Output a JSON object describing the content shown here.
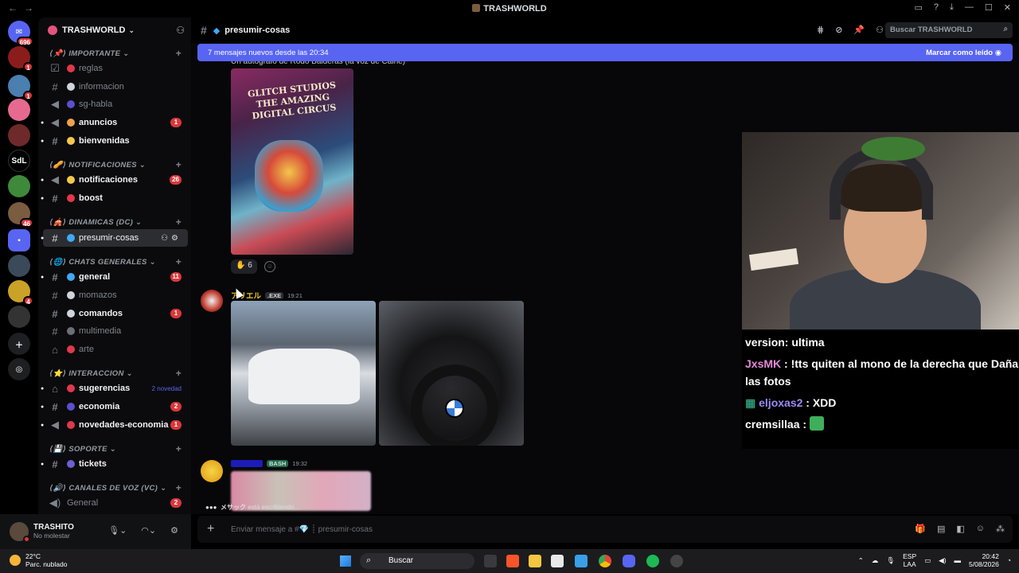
{
  "window": {
    "title": "TRASHWORLD",
    "nav_back": "←",
    "nav_forward": "→"
  },
  "rail": {
    "badges": [
      "696",
      "1",
      "1",
      "46",
      "4"
    ],
    "text_server": "SdL"
  },
  "server": {
    "name": "TRASHWORLD"
  },
  "sidebar": {
    "categories": [
      "IMPORTANTE",
      "NOTIFICACIONES",
      "DINAMICAS (DC)",
      "CHATS GENERALES",
      "INTERACCION",
      "SOPORTE",
      "CANALES DE VOZ (VC)"
    ],
    "channels": [
      {
        "label": "reglas"
      },
      {
        "label": "informacion"
      },
      {
        "label": "sg-habla"
      },
      {
        "label": "anuncios",
        "count": "1"
      },
      {
        "label": "bienvenidas"
      },
      {
        "label": "notificaciones",
        "count": "26"
      },
      {
        "label": "boost"
      },
      {
        "label": "presumir-cosas"
      },
      {
        "label": "general",
        "count": "11"
      },
      {
        "label": "momazos"
      },
      {
        "label": "comandos",
        "count": "1"
      },
      {
        "label": "multimedia"
      },
      {
        "label": "arte"
      },
      {
        "label": "sugerencias",
        "new": "2 novedad"
      },
      {
        "label": "economia",
        "count": "2"
      },
      {
        "label": "novedades-economia",
        "count": "1"
      },
      {
        "label": "tickets"
      },
      {
        "label": "General",
        "count": "2"
      }
    ]
  },
  "user": {
    "name": "TRASHITO",
    "status": "No molestar"
  },
  "channel_header": {
    "name": "presumir-cosas",
    "search_placeholder": "Buscar TRASHWORLD"
  },
  "new_messages_bar": {
    "text": "7 mensajes nuevos desde las 20:34",
    "action": "Marcar como leído"
  },
  "messages": {
    "m1_text": "Un autógrafo de Rodo Balderas (la voz de Caine)",
    "book_title": "GLITCH STUDIOS THE AMAZING DIGITAL CIRCUS",
    "reaction_count": "6",
    "m2_author": "アリエル",
    "m2_tag": ".EXE",
    "m2_time": "19:21",
    "m3_tag": "BASH",
    "m3_time": "19:32"
  },
  "typing": {
    "user": "メサック",
    "text": "está escribiendo..."
  },
  "input": {
    "placeholder": "Enviar mensaje a #💎 ┊ presumir-cosas"
  },
  "tts": {
    "lines": [
      {
        "user": "",
        "text": "version: ultima"
      },
      {
        "user": "JxsMK",
        "text": " : !tts quiten al mono de la derecha que Daña"
      },
      {
        "user": "",
        "text": "las fotos"
      },
      {
        "user": "eljoxas2",
        "text": " : XDD"
      },
      {
        "user": "cremsillaa",
        "text": " : "
      }
    ],
    "colors": {
      "JxsMK": "#e58ad9",
      "eljoxas2": "#9b8cf5",
      "cremsillaa": "#ffffff"
    }
  },
  "taskbar": {
    "temp": "22°C",
    "weather": "Parc. nublado",
    "search": "Buscar",
    "lang1": "ESP",
    "lang2": "LAA",
    "time": "20:42",
    "date": "5/08/2026"
  },
  "colors": {
    "accent": "#5865f2",
    "badge": "#da373c",
    "m2_author": "#f0c419",
    "m3_author": "#1c1cb8"
  }
}
